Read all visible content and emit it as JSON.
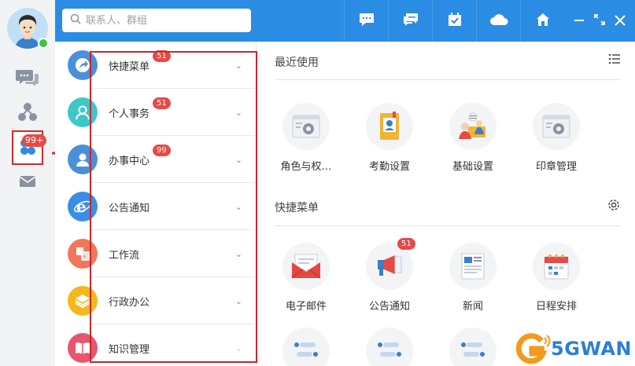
{
  "search": {
    "placeholder": "联系人、群组"
  },
  "rail": {
    "badge": "99+"
  },
  "menu": [
    {
      "label": "快捷菜单",
      "badge": "51",
      "color": "#4a90d9"
    },
    {
      "label": "个人事务",
      "badge": "51",
      "color": "#3ec7c9"
    },
    {
      "label": "办事中心",
      "badge": "99",
      "color": "#4a90d9"
    },
    {
      "label": "公告通知",
      "badge": "",
      "color": "#3a8ee6"
    },
    {
      "label": "工作流",
      "badge": "",
      "color": "#f0775a"
    },
    {
      "label": "行政办公",
      "badge": "",
      "color": "#f5b81c"
    },
    {
      "label": "知识管理",
      "badge": "",
      "color": "#e8556e"
    }
  ],
  "recent": {
    "title": "最近使用",
    "apps": [
      {
        "name": "角色与权…"
      },
      {
        "name": "考勤设置"
      },
      {
        "name": "基础设置"
      },
      {
        "name": "印章管理"
      }
    ]
  },
  "quick": {
    "title": "快捷菜单",
    "apps": [
      {
        "name": "电子邮件",
        "badge": ""
      },
      {
        "name": "公告通知",
        "badge": "51"
      },
      {
        "name": "新闻",
        "badge": ""
      },
      {
        "name": "日程安排",
        "badge": ""
      }
    ]
  },
  "watermark": {
    "text": "5GWAN"
  }
}
